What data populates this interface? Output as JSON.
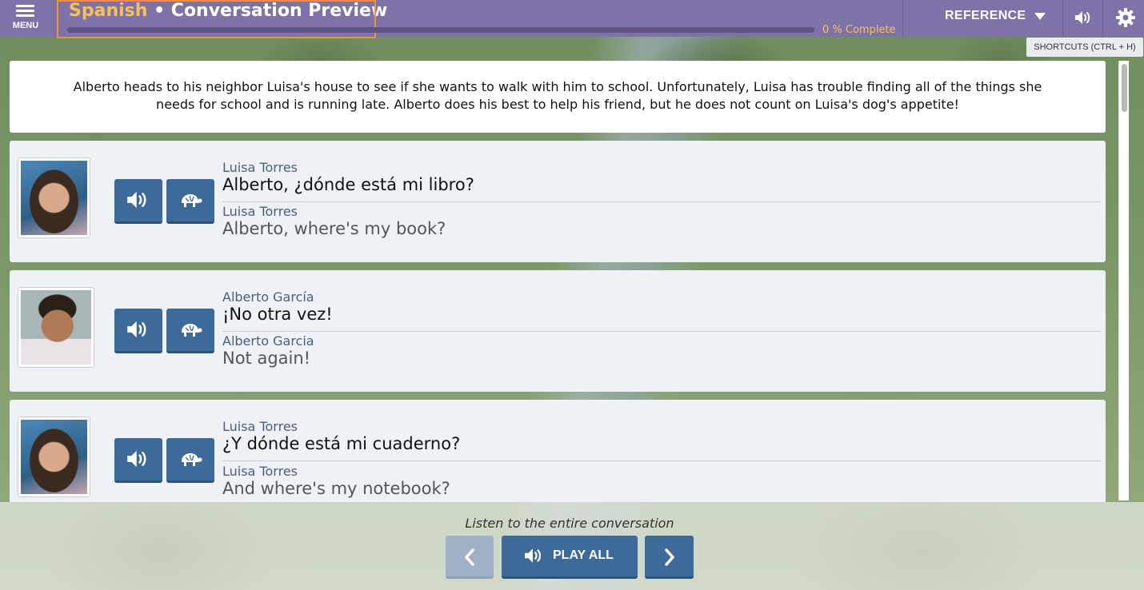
{
  "header": {
    "menu_label": "MENU",
    "title_language": "Spanish",
    "title_separator": " • ",
    "title_text": "Conversation Preview",
    "progress_percent": 0,
    "progress_text": "0 % Complete",
    "reference_label": "REFERENCE",
    "tooltip": "SHORTCUTS (CTRL + H)"
  },
  "intro": "Alberto heads to his neighbor Luisa's house to see if she wants to walk with him to school. Unfortunately, Luisa has trouble finding all of the things she needs for school and is running late. Alberto does his best to help his friend, but he does not count on Luisa's dog's appetite!",
  "lines": [
    {
      "speaker": "Luisa Torres",
      "target": "Alberto, ¿dónde está mi libro?",
      "speaker_translation": "Luisa Torres",
      "translation": "Alberto, where's my book?"
    },
    {
      "speaker": "Alberto García",
      "target": "¡No otra vez!",
      "speaker_translation": "Alberto Garcia",
      "translation": "Not again!"
    },
    {
      "speaker": "Luisa Torres",
      "target": "¿Y dónde está mi cuaderno?",
      "speaker_translation": "Luisa Torres",
      "translation": "And where's my notebook?"
    }
  ],
  "footer": {
    "listen_label": "Listen to the entire conversation",
    "play_all_label": "PLAY ALL"
  },
  "colors": {
    "topbar": "#7e72a8",
    "accent": "#f5c25a",
    "button": "#3e6a99",
    "highlight_border": "#f0913a"
  },
  "icons": {
    "menu": "hamburger-icon",
    "reference": "caret-down-icon",
    "volume": "speaker-icon",
    "settings": "gear-icon",
    "play": "speaker-icon",
    "slow": "turtle-icon",
    "prev": "chevron-left-icon",
    "next": "chevron-right-icon"
  }
}
